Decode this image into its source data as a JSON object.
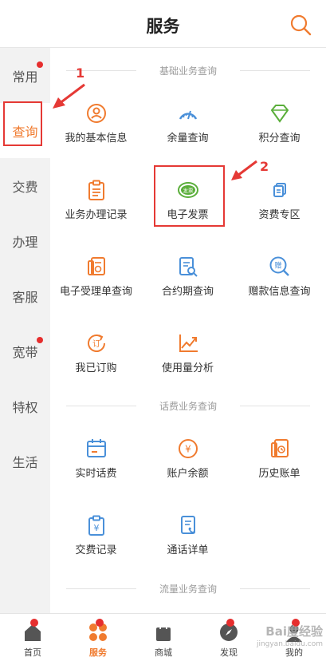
{
  "header": {
    "title": "服务"
  },
  "sidebar": {
    "items": [
      {
        "label": "常用",
        "dot": true
      },
      {
        "label": "查询",
        "active": true
      },
      {
        "label": "交费"
      },
      {
        "label": "办理"
      },
      {
        "label": "客服"
      },
      {
        "label": "宽带",
        "dot": true
      },
      {
        "label": "特权"
      },
      {
        "label": "生活"
      }
    ]
  },
  "sections": {
    "basic": {
      "title": "基础业务查询",
      "items": [
        {
          "label": "我的基本信息",
          "icon": "user-info-icon"
        },
        {
          "label": "余量查询",
          "icon": "gauge-icon"
        },
        {
          "label": "积分查询",
          "icon": "diamond-icon"
        },
        {
          "label": "业务办理记录",
          "icon": "clipboard-icon"
        },
        {
          "label": "电子发票",
          "icon": "invoice-icon"
        },
        {
          "label": "资费专区",
          "icon": "cards-icon"
        },
        {
          "label": "电子受理单查询",
          "icon": "receipt-icon"
        },
        {
          "label": "合约期查询",
          "icon": "document-search-icon"
        },
        {
          "label": "赠款信息查询",
          "icon": "gift-search-icon"
        },
        {
          "label": "我已订购",
          "icon": "subscribed-icon"
        },
        {
          "label": "使用量分析",
          "icon": "trend-chart-icon"
        }
      ]
    },
    "bill": {
      "title": "话费业务查询",
      "items": [
        {
          "label": "实时话费",
          "icon": "calendar-icon"
        },
        {
          "label": "账户余额",
          "icon": "yuan-coin-icon"
        },
        {
          "label": "历史账单",
          "icon": "bill-history-icon"
        },
        {
          "label": "交费记录",
          "icon": "payment-record-icon"
        },
        {
          "label": "通话详单",
          "icon": "call-detail-icon"
        }
      ]
    },
    "data": {
      "title": "流量业务查询"
    }
  },
  "icon_glyphs": {
    "invoice": "发票",
    "subscribed": "订",
    "gift": "赠",
    "yuan": "¥"
  },
  "annotations": {
    "one": "1",
    "two": "2"
  },
  "tabbar": {
    "items": [
      {
        "label": "首页",
        "dot": true
      },
      {
        "label": "服务",
        "active": true,
        "dot": true
      },
      {
        "label": "商城"
      },
      {
        "label": "发现",
        "dot": true
      },
      {
        "label": "我的",
        "dot": true
      }
    ]
  },
  "watermark": {
    "text": "Bai度经验",
    "sub": "jingyan.baidu.com"
  },
  "colors": {
    "accent": "#f07b2f",
    "blue": "#4a90d9",
    "green": "#5aae3a",
    "badge": "#e62e2e",
    "annotation": "#e53935"
  }
}
